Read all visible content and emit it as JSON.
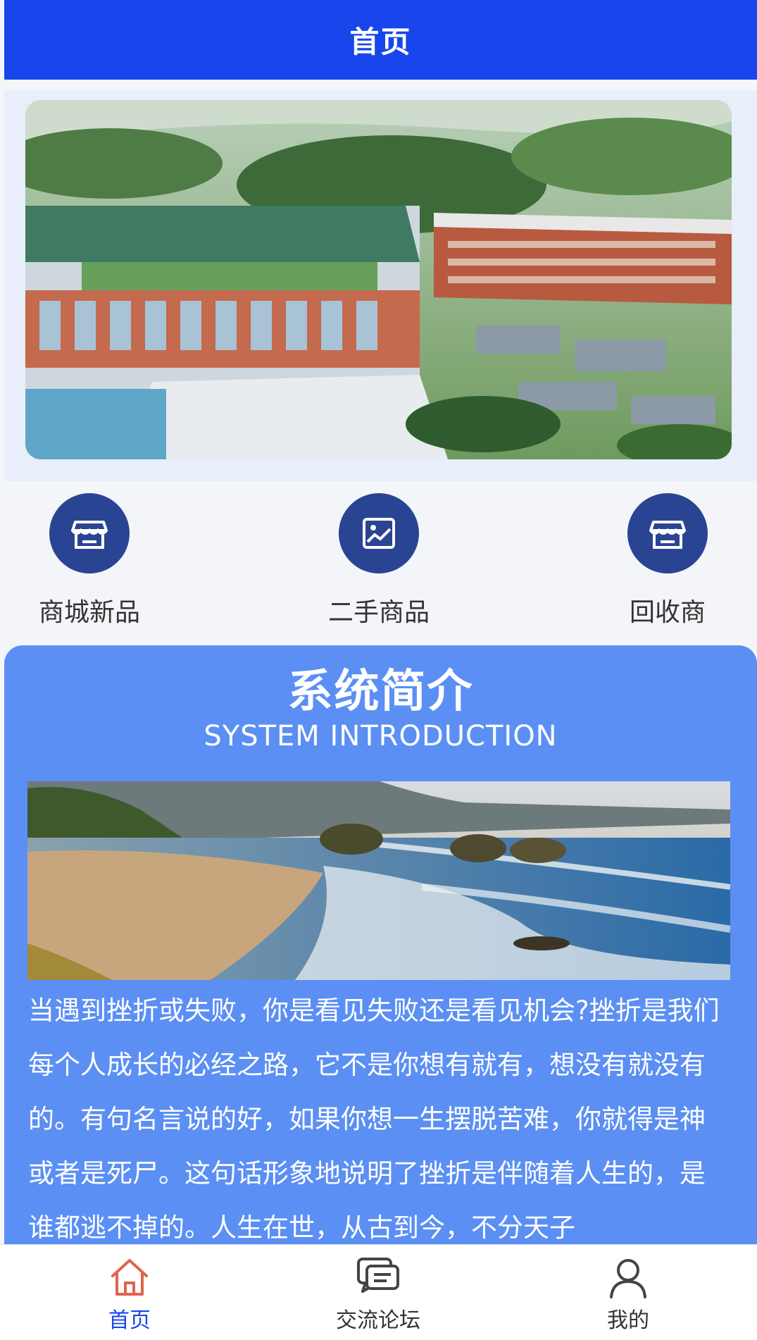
{
  "header": {
    "title": "首页"
  },
  "categories": [
    {
      "label": "商城新品",
      "icon": "store-icon"
    },
    {
      "label": "二手商品",
      "icon": "chart-image-icon"
    },
    {
      "label": "回收商",
      "icon": "store-icon"
    }
  ],
  "intro": {
    "title": "系统简介",
    "subtitle": "SYSTEM INTRODUCTION",
    "text": "当遇到挫折或失败，你是看见失败还是看见机会?挫折是我们每个人成长的必经之路，它不是你想有就有，想没有就没有的。有句名言说的好，如果你想一生摆脱苦难，你就得是神或者是死尸。这句话形象地说明了挫折是伴随着人生的，是谁都逃不掉的。人生在世，从古到今，不分天子"
  },
  "tabbar": {
    "tabs": [
      {
        "label": "首页",
        "icon": "home-icon",
        "active": true
      },
      {
        "label": "交流论坛",
        "icon": "chat-icon",
        "active": false
      },
      {
        "label": "我的",
        "icon": "user-icon",
        "active": false
      }
    ]
  },
  "colors": {
    "header": "#1846ec",
    "category_circle": "#2a4494",
    "intro_panel": "#5b8ff4",
    "tab_active": "#1846ec",
    "tab_active_icon": "#e0644b",
    "tab_inactive": "#333333"
  }
}
